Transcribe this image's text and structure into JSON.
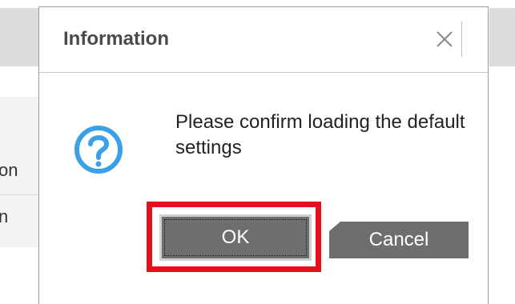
{
  "dialog": {
    "title": "Information",
    "close_glyph": "×",
    "icon": "question-circle-icon",
    "message": "Please confirm loading the default settings",
    "ok_label": "OK",
    "cancel_label": "Cancel"
  },
  "background": {
    "fragment_1": "on",
    "fragment_2": "n"
  },
  "colors": {
    "accent": "#3aa0e8",
    "highlight": "#e3101c",
    "button_bg": "#6e6e6e"
  }
}
